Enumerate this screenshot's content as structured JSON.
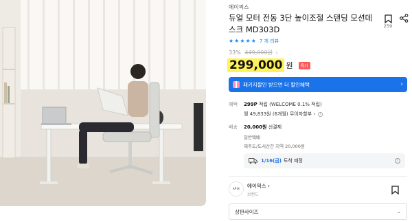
{
  "product": {
    "brand": "에이픽스",
    "title": "듀얼 모터 전동 3단 높이조절 스탠딩 모션데스크 MD303D",
    "bookmark_count": "259",
    "star_glyphs": [
      "★",
      "★",
      "★",
      "★",
      "★"
    ],
    "rating_value": 5,
    "review_label": "7 개 리뷰",
    "discount_rate": "33%",
    "original_price": "449,000원",
    "discount_chevron": "›",
    "price": "299,000",
    "price_unit": "원",
    "special_badge": "특가"
  },
  "coupon": {
    "label": "패키지할인 받으면 더 할인혜택",
    "arrow": "›"
  },
  "benefit": {
    "label": "혜택",
    "points_value": "299P",
    "points_text": "적립 (WELCOME 0.1% 적립)",
    "installment": "월 49,833원 (6개월) 무이자할부",
    "installment_chevron": "›",
    "info_glyph": "?"
  },
  "shipping": {
    "label": "배송",
    "fee": "20,000원",
    "fee_suffix": "선결제",
    "type": "일반택배",
    "note": "제주도/도서산간 지역 20,000원",
    "arrival_date": "1/16(금)",
    "arrival_text": "도착 예정",
    "info_glyph": "i"
  },
  "seller": {
    "logo_text": "APIX",
    "name": "에이픽스 ›",
    "sub": "브랜드"
  },
  "option_select": {
    "selected": "상판사이즈",
    "caret": "⌄"
  },
  "colors": {
    "accent": "#1a73e8",
    "price_highlight": "#fff25a",
    "badge_red": "#ff5a5a",
    "star": "#1e88e5"
  },
  "icons": {
    "bookmark": "bookmark-icon",
    "share": "share-icon",
    "gift": "gift-icon",
    "truck": "truck-icon",
    "info": "info-icon"
  }
}
